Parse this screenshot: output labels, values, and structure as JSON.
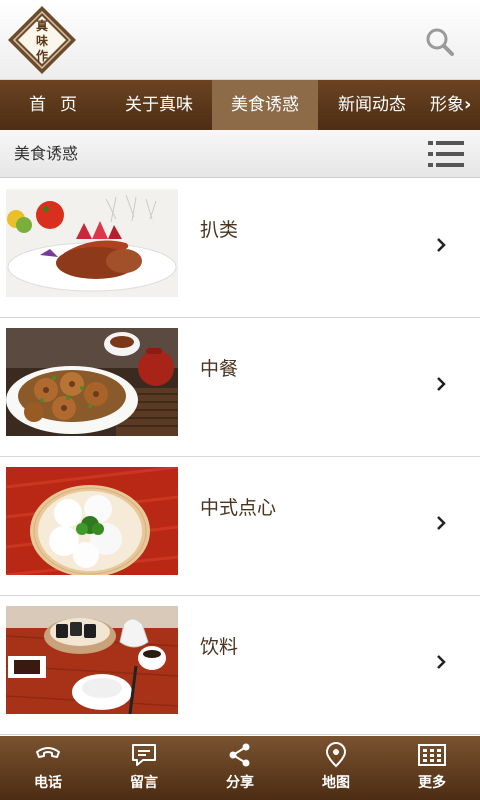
{
  "header": {
    "logo_text": [
      "真",
      "味",
      "作"
    ],
    "logo_icon": "diamond-logo",
    "search_icon": "search-icon"
  },
  "nav": {
    "items": [
      {
        "label": "首页",
        "active": false
      },
      {
        "label": "关于真味",
        "active": false
      },
      {
        "label": "美食诱惑",
        "active": true
      },
      {
        "label": "新闻动态",
        "active": false
      },
      {
        "label": "形象",
        "active": false
      }
    ],
    "more_icon": "chevron-right-icon"
  },
  "section": {
    "title": "美食诱惑",
    "menu_icon": "list-icon"
  },
  "items": [
    {
      "title": "扒类",
      "image": "steak-plate-photo"
    },
    {
      "title": "中餐",
      "image": "lotus-root-dish-photo"
    },
    {
      "title": "中式点心",
      "image": "steamed-buns-photo"
    },
    {
      "title": "饮料",
      "image": "tea-and-drinks-photo"
    }
  ],
  "bottom_nav": [
    {
      "label": "电话",
      "icon": "phone-icon"
    },
    {
      "label": "留言",
      "icon": "message-icon"
    },
    {
      "label": "分享",
      "icon": "share-icon"
    },
    {
      "label": "地图",
      "icon": "map-pin-icon"
    },
    {
      "label": "更多",
      "icon": "grid-icon"
    }
  ],
  "colors": {
    "brand_brown": "#5a3818",
    "nav_active": "#8d6a48",
    "title_text": "#4a3420"
  }
}
